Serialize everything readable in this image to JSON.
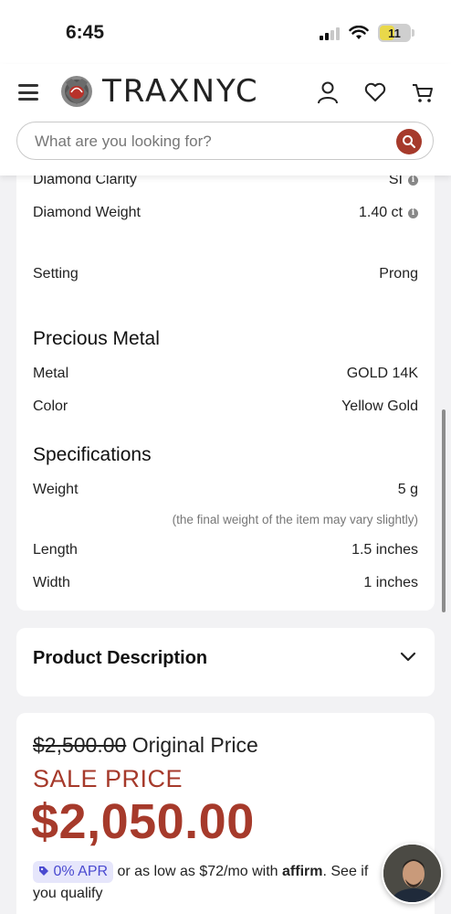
{
  "status_bar": {
    "time": "6:45",
    "battery": "11"
  },
  "header": {
    "brand": "TRAXNYC",
    "search_placeholder": "What are you looking for?"
  },
  "specs": {
    "rows_top": [
      {
        "label": "Diamond Clarity",
        "value": "SI",
        "info": true
      },
      {
        "label": "Diamond Weight",
        "value": "1.40 ct",
        "info": true
      },
      {
        "label": "Setting",
        "value": "Prong",
        "info": false
      }
    ],
    "precious_metal": {
      "title": "Precious Metal",
      "rows": [
        {
          "label": "Metal",
          "value": "GOLD 14K"
        },
        {
          "label": "Color",
          "value": "Yellow Gold"
        }
      ]
    },
    "specifications": {
      "title": "Specifications",
      "weight": {
        "label": "Weight",
        "value": "5 g"
      },
      "note": "(the final weight of the item may vary slightly)",
      "rows": [
        {
          "label": "Length",
          "value": "1.5 inches"
        },
        {
          "label": "Width",
          "value": "1 inches"
        }
      ]
    }
  },
  "description": {
    "title": "Product Description"
  },
  "price": {
    "original_amount": "$2,500.00",
    "original_label": "Original Price",
    "sale_label": "SALE PRICE",
    "sale_amount": "$2,050.00",
    "apr_badge": "0% APR",
    "affirm_text_1": "or as low as $72/mo with",
    "affirm_brand": "affirm",
    "affirm_text_2": ". See if you qualify"
  },
  "colors": {
    "accent": "#a63a2b",
    "apr": "#4a4ad0"
  }
}
